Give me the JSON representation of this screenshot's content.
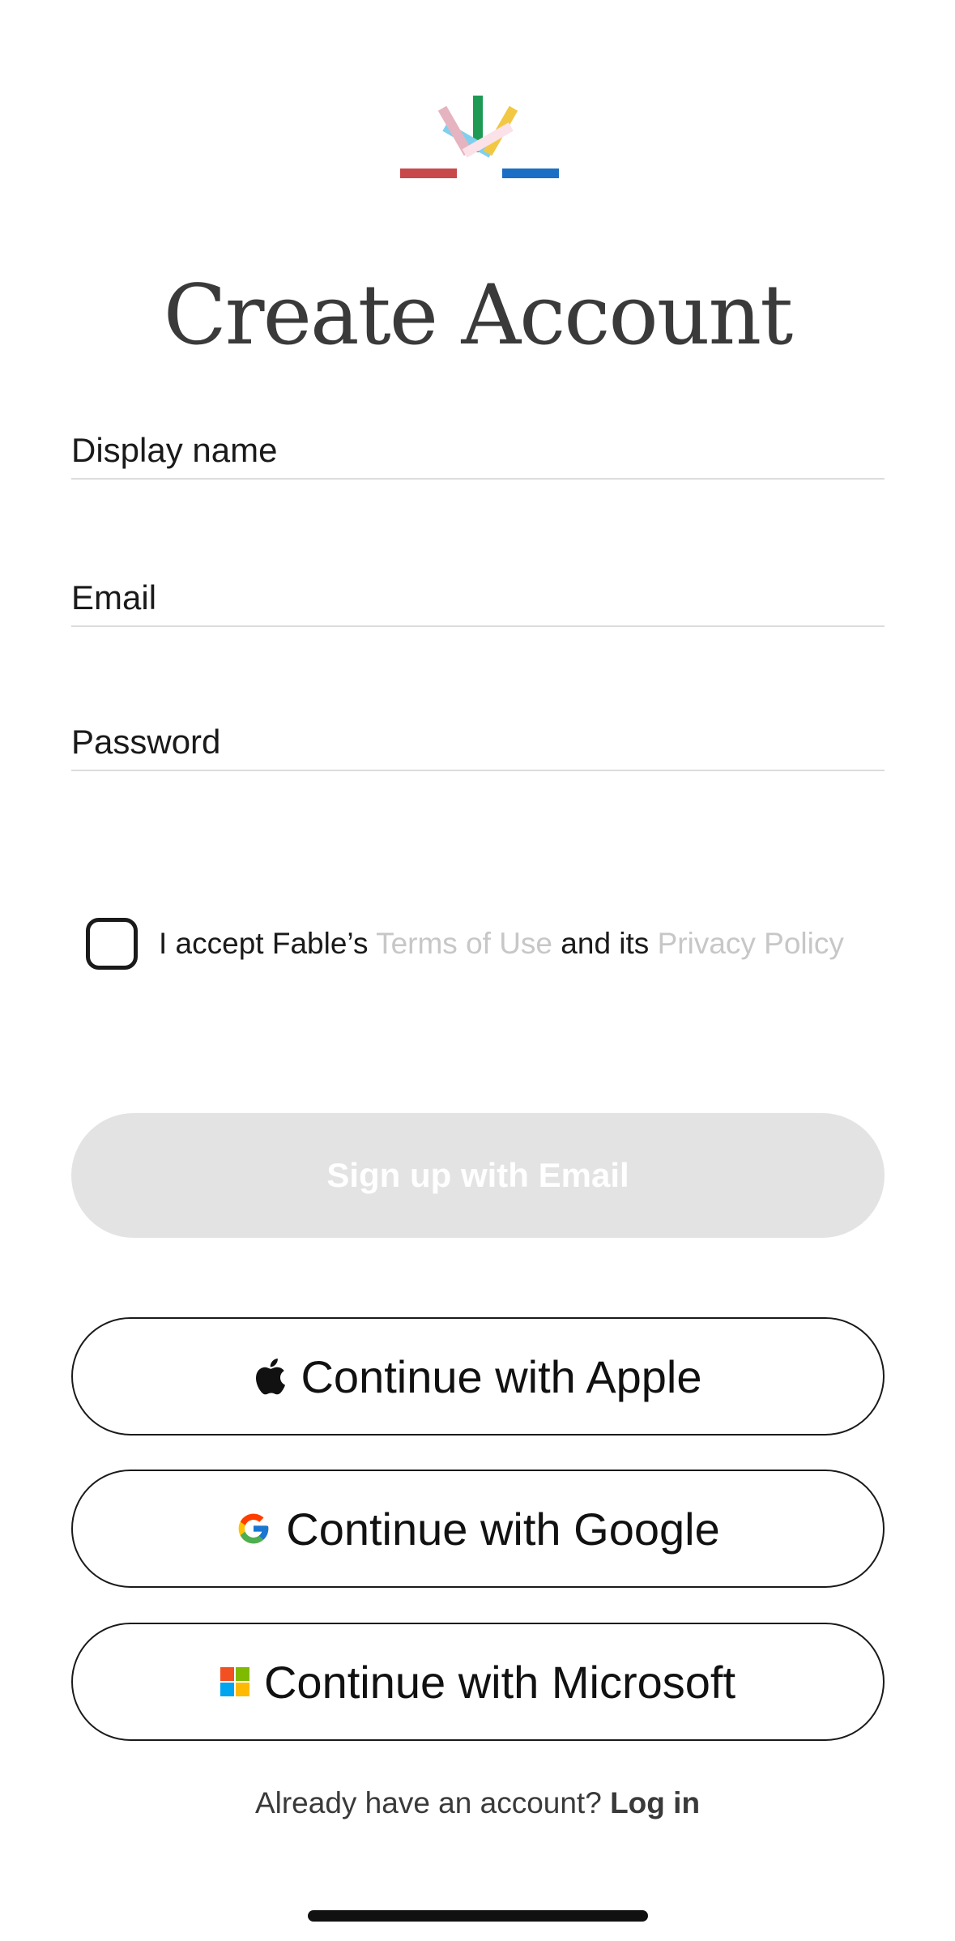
{
  "logo": {
    "colors": [
      "#c9484a",
      "#7fd0ee",
      "#e6b3c0",
      "#1e9a55",
      "#f2c744",
      "#fbe1e8",
      "#1a6fc4"
    ]
  },
  "header": {
    "title": "Create Account"
  },
  "form": {
    "display_name_placeholder": "Display name",
    "email_placeholder": "Email",
    "password_placeholder": "Password"
  },
  "consent": {
    "prefix": "I accept Fable’s ",
    "terms_link": "Terms of Use",
    "middle": " and its ",
    "privacy_link": "Privacy Policy"
  },
  "buttons": {
    "email_signup": "Sign up with Email",
    "apple": "Continue with Apple",
    "google": "Continue with Google",
    "microsoft": "Continue with Microsoft"
  },
  "footer": {
    "prompt": "Already have an account? ",
    "login_link": "Log in"
  },
  "icons": {
    "apple": "apple-icon",
    "google": "google-icon",
    "microsoft": "microsoft-icon"
  }
}
